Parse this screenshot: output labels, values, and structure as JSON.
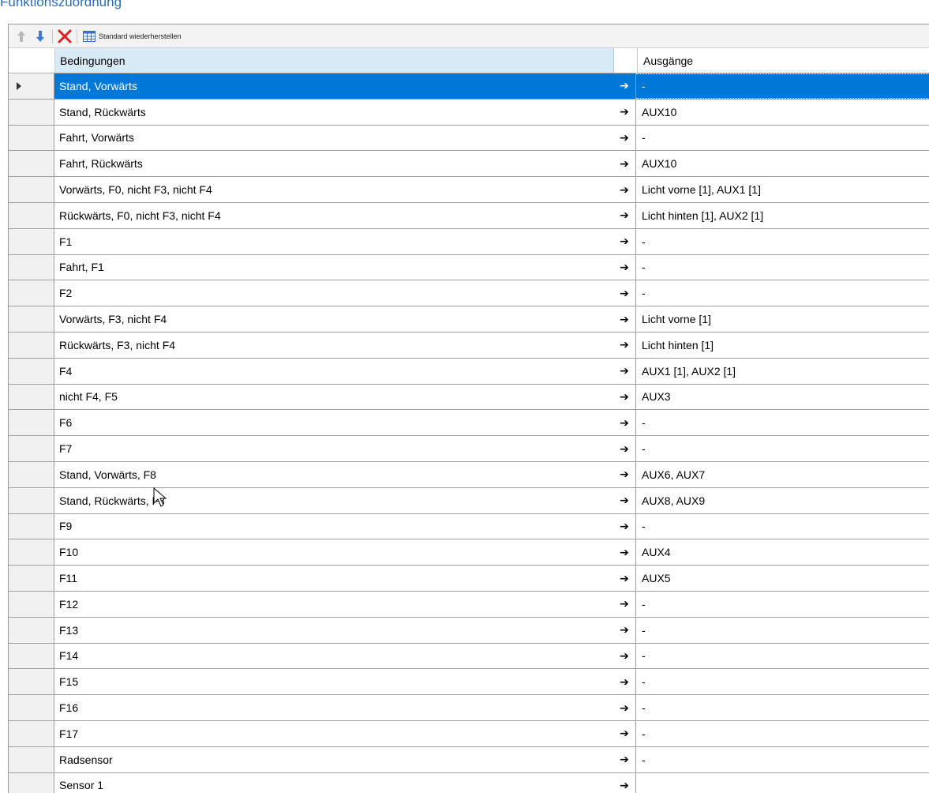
{
  "section_title": "Funktionszuordnung",
  "toolbar": {
    "restore_label": "Standard wiederherstellen"
  },
  "grid": {
    "headers": {
      "conditions": "Bedingungen",
      "outputs": "Ausgänge"
    },
    "arrow": "➔",
    "selected_index": 0,
    "rows": [
      {
        "cond": "Stand, Vorwärts",
        "out": "-"
      },
      {
        "cond": "Stand, Rückwärts",
        "out": "AUX10"
      },
      {
        "cond": "Fahrt, Vorwärts",
        "out": "-"
      },
      {
        "cond": "Fahrt, Rückwärts",
        "out": "AUX10"
      },
      {
        "cond": "Vorwärts, F0, nicht F3, nicht F4",
        "out": "Licht vorne [1], AUX1 [1]"
      },
      {
        "cond": "Rückwärts, F0, nicht F3, nicht F4",
        "out": "Licht hinten [1], AUX2 [1]"
      },
      {
        "cond": "F1",
        "out": "-"
      },
      {
        "cond": "Fahrt, F1",
        "out": "-"
      },
      {
        "cond": "F2",
        "out": "-"
      },
      {
        "cond": "Vorwärts, F3, nicht F4",
        "out": "Licht vorne [1]"
      },
      {
        "cond": "Rückwärts, F3, nicht F4",
        "out": "Licht hinten [1]"
      },
      {
        "cond": "F4",
        "out": "AUX1 [1], AUX2 [1]"
      },
      {
        "cond": "nicht F4, F5",
        "out": "AUX3"
      },
      {
        "cond": "F6",
        "out": "-"
      },
      {
        "cond": "F7",
        "out": "-"
      },
      {
        "cond": "Stand, Vorwärts, F8",
        "out": "AUX6, AUX7"
      },
      {
        "cond": "Stand, Rückwärts, F8",
        "out": "AUX8, AUX9"
      },
      {
        "cond": "F9",
        "out": "-"
      },
      {
        "cond": "F10",
        "out": "AUX4"
      },
      {
        "cond": "F11",
        "out": "AUX5"
      },
      {
        "cond": "F12",
        "out": "-"
      },
      {
        "cond": "F13",
        "out": "-"
      },
      {
        "cond": "F14",
        "out": "-"
      },
      {
        "cond": "F15",
        "out": "-"
      },
      {
        "cond": "F16",
        "out": "-"
      },
      {
        "cond": "F17",
        "out": "-"
      },
      {
        "cond": "Radsensor",
        "out": "-"
      },
      {
        "cond": "Sensor 1",
        "out": ""
      }
    ]
  },
  "icons": {
    "move_up": "arrow-up-icon",
    "move_down": "arrow-down-icon",
    "delete": "red-x-icon",
    "restore": "table-grid-icon",
    "row_pointer": "triangle-right-icon"
  },
  "colors": {
    "selection": "#0078d7",
    "header_highlight": "#d9eaf7",
    "title": "#2a6ebb",
    "delete_red": "#e02020"
  }
}
